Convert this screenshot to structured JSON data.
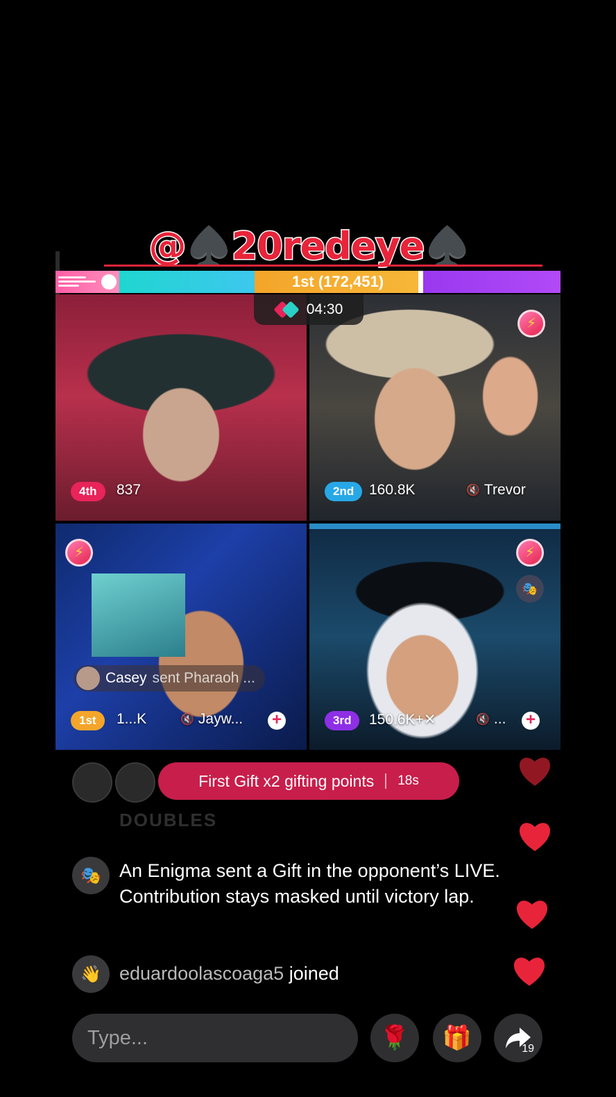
{
  "title": "@♠️20redeye♠️",
  "score_bar": {
    "leader_label": "1st (172,451)"
  },
  "timer": {
    "time": "04:30"
  },
  "tiles": [
    {
      "rank": "4th",
      "score": "837",
      "name": ""
    },
    {
      "rank": "2nd",
      "score": "160.8K",
      "name": "Trevor"
    },
    {
      "rank": "1st",
      "score": "1...K",
      "name": "Jayw...",
      "gift_user": "Casey",
      "gift_action": "sent Pharaoh ..."
    },
    {
      "rank": "3rd",
      "score": "150.6K+✕",
      "name": "..."
    }
  ],
  "gift_pill": {
    "label": "First Gift x2 gifting points",
    "countdown": "18s"
  },
  "faded_text": "DOUBLES",
  "chat": [
    {
      "icon": "mask-icon",
      "text": "An Enigma sent a Gift in the opponent’s LIVE. Contribution stays masked until victory lap."
    },
    {
      "icon": "wave-icon",
      "user": "eduardoolascoaga5",
      "action": "joined"
    }
  ],
  "composer": {
    "placeholder": "Type...",
    "share_count": "19"
  },
  "colors": {
    "accent_pink": "#e8245a",
    "pill_red": "#c81e4b",
    "heart_red": "#e8243a"
  }
}
